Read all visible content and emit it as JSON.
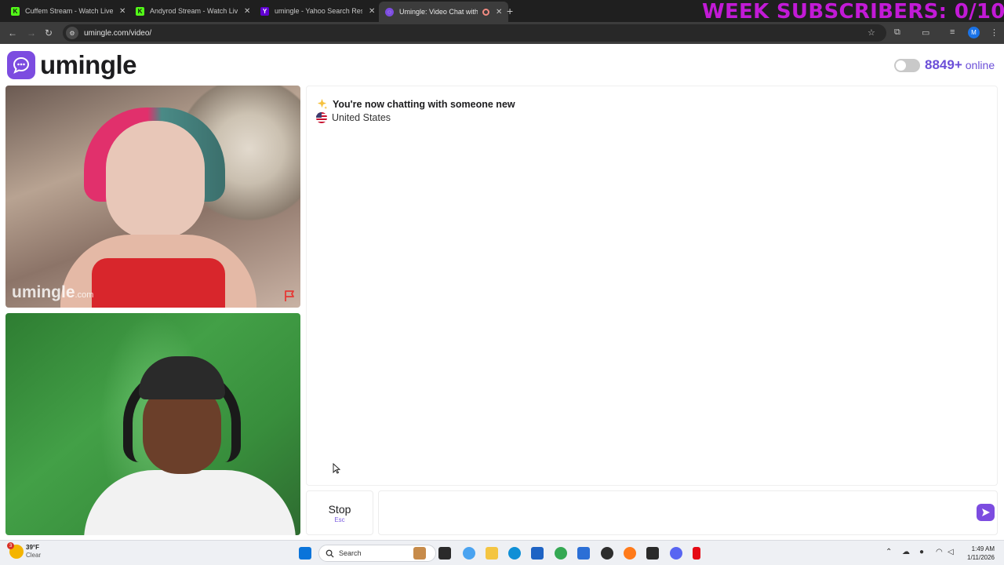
{
  "browser": {
    "tabs": [
      {
        "title": "Cuffem Stream - Watch Live on",
        "favicon": "kick-icon",
        "color": "#53fc18"
      },
      {
        "title": "Andyrod Stream - Watch Live o",
        "favicon": "kick-icon",
        "color": "#53fc18"
      },
      {
        "title": "umingle - Yahoo Search Results",
        "favicon": "yahoo-icon",
        "color": "#6001d2"
      },
      {
        "title": "Umingle: Video Chat with S",
        "favicon": "umingle-icon",
        "color": "#7c4ce0"
      }
    ],
    "active_tab": 3,
    "url": "umingle.com/video/",
    "profile_initial": "M"
  },
  "stream_overlay": {
    "text": "WEEK SUBSCRIBERS: 0/10",
    "color": "#c21ad6"
  },
  "site": {
    "logo_text": "umingle",
    "online_count": "8849+",
    "online_label": "online",
    "accent_color": "#7c4ce0"
  },
  "stranger_video": {
    "watermark": "umingle",
    "watermark_suffix": ".com"
  },
  "chat": {
    "system_message": "You're now chatting with someone new",
    "country": "United States"
  },
  "controls": {
    "stop_label": "Stop",
    "stop_shortcut": "Esc",
    "message_placeholder": ""
  },
  "taskbar": {
    "weather_temp": "39°F",
    "weather_desc": "Clear",
    "weather_badge": "3",
    "search_label": "Search",
    "time": "1:49 AM",
    "date": "1/11/2026"
  }
}
